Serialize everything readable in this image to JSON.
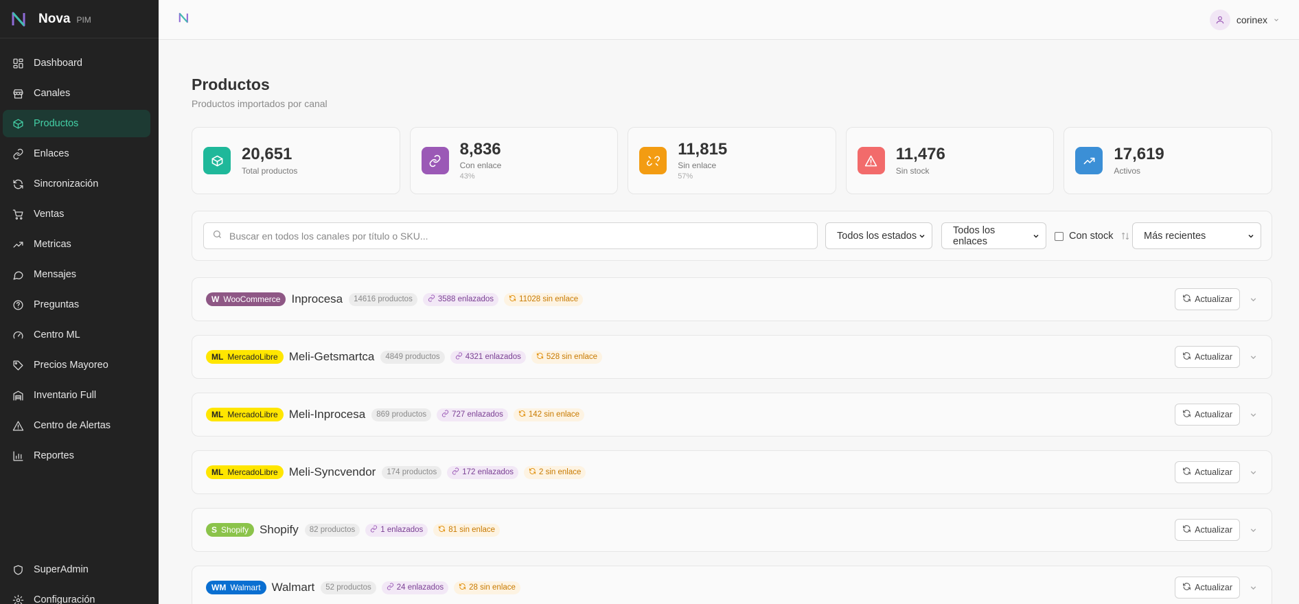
{
  "brand": {
    "name": "Nova",
    "sub": "PIM"
  },
  "sidebar": {
    "items": [
      {
        "label": "Dashboard",
        "icon": "grid-icon",
        "active": false
      },
      {
        "label": "Canales",
        "icon": "store-icon",
        "active": false
      },
      {
        "label": "Productos",
        "icon": "box-icon",
        "active": true
      },
      {
        "label": "Enlaces",
        "icon": "link-icon",
        "active": false
      },
      {
        "label": "Sincronización",
        "icon": "refresh-icon",
        "active": false
      },
      {
        "label": "Ventas",
        "icon": "cart-icon",
        "active": false
      },
      {
        "label": "Metricas",
        "icon": "trending-up-icon",
        "active": false
      },
      {
        "label": "Mensajes",
        "icon": "message-icon",
        "active": false
      },
      {
        "label": "Preguntas",
        "icon": "help-circle-icon",
        "active": false
      },
      {
        "label": "Centro ML",
        "icon": "gauge-icon",
        "active": false
      },
      {
        "label": "Precios Mayoreo",
        "icon": "tag-icon",
        "active": false
      },
      {
        "label": "Inventario Full",
        "icon": "warehouse-icon",
        "active": false
      },
      {
        "label": "Centro de Alertas",
        "icon": "alert-triangle-icon",
        "active": false
      },
      {
        "label": "Reportes",
        "icon": "bar-chart-icon",
        "active": false
      }
    ],
    "bottom": [
      {
        "label": "SuperAdmin",
        "icon": "shield-icon"
      },
      {
        "label": "Configuración",
        "icon": "gear-icon"
      }
    ]
  },
  "topbar": {
    "username": "corinex"
  },
  "page": {
    "title": "Productos",
    "subtitle": "Productos importados por canal"
  },
  "stats": [
    {
      "value": "20,651",
      "label": "Total productos",
      "pct": "",
      "color": "#1fb89a",
      "icon": "box-icon"
    },
    {
      "value": "8,836",
      "label": "Con enlace",
      "pct": "43%",
      "color": "#9b59b6",
      "icon": "link-icon"
    },
    {
      "value": "11,815",
      "label": "Sin enlace",
      "pct": "57%",
      "color": "#f39c12",
      "icon": "unlink-icon"
    },
    {
      "value": "11,476",
      "label": "Sin stock",
      "pct": "",
      "color": "#f26b6b",
      "icon": "alert-triangle-icon"
    },
    {
      "value": "17,619",
      "label": "Activos",
      "pct": "",
      "color": "#3b8fd6",
      "icon": "trending-up-icon"
    }
  ],
  "filters": {
    "search_placeholder": "Buscar en todos los canales por título o SKU...",
    "status_select": "Todos los estados",
    "link_select": "Todos los enlaces",
    "stock_label": "Con stock",
    "sort_select": "Más recientes"
  },
  "channels": [
    {
      "code": "W",
      "platform": "WooCommerce",
      "name": "Inprocesa",
      "count": "14616 productos",
      "linked": "3588 enlazados",
      "unlinked": "11028 sin enlace",
      "badge_bg": "#8e5785",
      "badge_fg": "#ffffff"
    },
    {
      "code": "ML",
      "platform": "MercadoLibre",
      "name": "Meli-Getsmartca",
      "count": "4849 productos",
      "linked": "4321 enlazados",
      "unlinked": "528 sin enlace",
      "badge_bg": "#ffe600",
      "badge_fg": "#222222"
    },
    {
      "code": "ML",
      "platform": "MercadoLibre",
      "name": "Meli-Inprocesa",
      "count": "869 productos",
      "linked": "727 enlazados",
      "unlinked": "142 sin enlace",
      "badge_bg": "#ffe600",
      "badge_fg": "#222222"
    },
    {
      "code": "ML",
      "platform": "MercadoLibre",
      "name": "Meli-Syncvendor",
      "count": "174 productos",
      "linked": "172 enlazados",
      "unlinked": "2 sin enlace",
      "badge_bg": "#ffe600",
      "badge_fg": "#222222"
    },
    {
      "code": "S",
      "platform": "Shopify",
      "name": "Shopify",
      "count": "82 productos",
      "linked": "1 enlazados",
      "unlinked": "81 sin enlace",
      "badge_bg": "#8bc34a",
      "badge_fg": "#ffffff"
    },
    {
      "code": "WM",
      "platform": "Walmart",
      "name": "Walmart",
      "count": "52 productos",
      "linked": "24 enlazados",
      "unlinked": "28 sin enlace",
      "badge_bg": "#0a6fd1",
      "badge_fg": "#ffffff"
    }
  ],
  "action_label": "Actualizar"
}
